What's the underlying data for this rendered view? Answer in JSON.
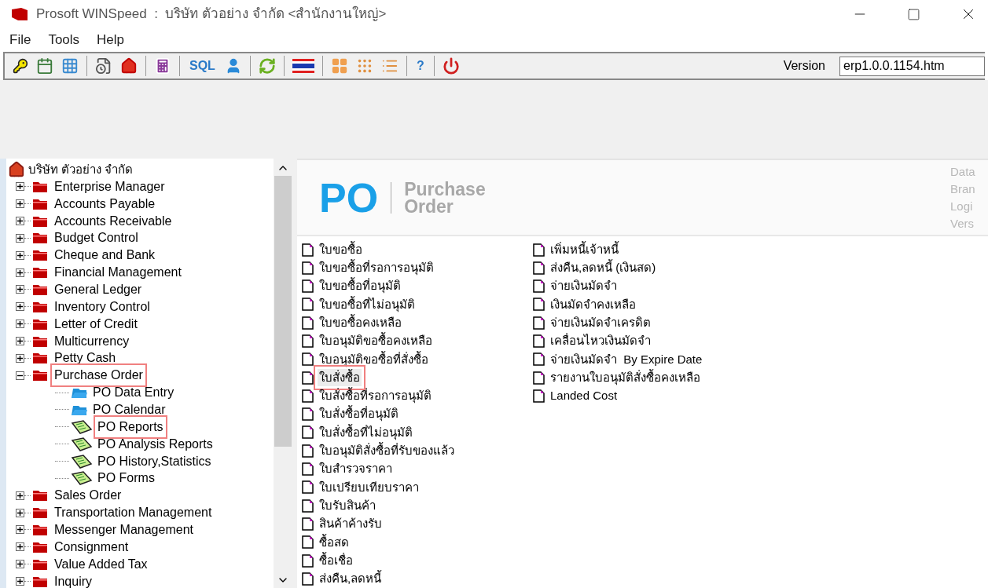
{
  "window": {
    "title": "Prosoft WINSpeed  :  บริษัท ตัวอย่าง จำกัด <สำนักงานใหญ่>"
  },
  "menu": [
    "File",
    "Tools",
    "Help"
  ],
  "toolbar": [
    {
      "kind": "key"
    },
    {
      "kind": "calendar"
    },
    {
      "kind": "grid"
    },
    {
      "kind": "separator"
    },
    {
      "kind": "history"
    },
    {
      "kind": "home"
    },
    {
      "kind": "separator"
    },
    {
      "kind": "calculator"
    },
    {
      "kind": "separator"
    },
    {
      "kind": "text",
      "label": "SQL"
    },
    {
      "kind": "user"
    },
    {
      "kind": "separator"
    },
    {
      "kind": "refresh"
    },
    {
      "kind": "separator"
    },
    {
      "kind": "flag"
    },
    {
      "kind": "separator"
    },
    {
      "kind": "tiles"
    },
    {
      "kind": "tiles-small"
    },
    {
      "kind": "list"
    },
    {
      "kind": "separator"
    },
    {
      "kind": "text",
      "label": "?"
    },
    {
      "kind": "separator"
    },
    {
      "kind": "power"
    }
  ],
  "version": {
    "label": "Version",
    "value": "erp1.0.0.1154.htm"
  },
  "tree": {
    "root": "บริษัท ตัวอย่าง จำกัด",
    "items": [
      {
        "label": "Enterprise Manager",
        "expanded": false,
        "highlighted": false
      },
      {
        "label": "Accounts Payable",
        "expanded": false,
        "highlighted": false
      },
      {
        "label": "Accounts Receivable",
        "expanded": false,
        "highlighted": false
      },
      {
        "label": "Budget Control",
        "expanded": false,
        "highlighted": false
      },
      {
        "label": "Cheque and Bank",
        "expanded": false,
        "highlighted": false
      },
      {
        "label": "Financial Management",
        "expanded": false,
        "highlighted": false
      },
      {
        "label": "General Ledger",
        "expanded": false,
        "highlighted": false
      },
      {
        "label": "Inventory Control",
        "expanded": false,
        "highlighted": false
      },
      {
        "label": "Letter of Credit",
        "expanded": false,
        "highlighted": false
      },
      {
        "label": "Multicurrency",
        "expanded": false,
        "highlighted": false
      },
      {
        "label": "Petty Cash",
        "expanded": false,
        "highlighted": false
      },
      {
        "label": "Purchase Order",
        "expanded": true,
        "highlighted": true,
        "children": [
          {
            "label": "PO Data Entry",
            "kind": "folder",
            "highlighted": false
          },
          {
            "label": "PO Calendar",
            "kind": "folder",
            "highlighted": false
          },
          {
            "label": "PO Reports",
            "kind": "report",
            "highlighted": true
          },
          {
            "label": "PO Analysis Reports",
            "kind": "report",
            "highlighted": false
          },
          {
            "label": "PO History,Statistics",
            "kind": "report",
            "highlighted": false
          },
          {
            "label": "PO Forms",
            "kind": "report",
            "highlighted": false
          }
        ]
      },
      {
        "label": "Sales Order",
        "expanded": false,
        "highlighted": false
      },
      {
        "label": "Transportation Management",
        "expanded": false,
        "highlighted": false
      },
      {
        "label": "Messenger Management",
        "expanded": false,
        "highlighted": false
      },
      {
        "label": "Consignment",
        "expanded": false,
        "highlighted": false
      },
      {
        "label": "Value Added Tax",
        "expanded": false,
        "highlighted": false
      },
      {
        "label": "Inquiry",
        "expanded": false,
        "highlighted": false
      }
    ]
  },
  "header": {
    "logo": "PO",
    "title_lines": [
      "Purchase",
      "Order"
    ],
    "info": [
      "Data",
      "Bran",
      "Logi",
      "Vers"
    ]
  },
  "reports": [
    [
      {
        "label": "ใบขอซื้อ",
        "selected": false,
        "highlighted": false
      },
      {
        "label": "ใบขอซื้อที่รอการอนุมัติ",
        "selected": false,
        "highlighted": false
      },
      {
        "label": "ใบขอซื้อที่อนุมัติ",
        "selected": false,
        "highlighted": false
      },
      {
        "label": "ใบขอซื้อที่ไม่อนุมัติ",
        "selected": false,
        "highlighted": false
      },
      {
        "label": "ใบขอซื้อคงเหลือ",
        "selected": false,
        "highlighted": false
      },
      {
        "label": "ใบอนุมัติขอซื้อคงเหลือ",
        "selected": false,
        "highlighted": false
      },
      {
        "label": "ใบอนุมัติขอซื้อที่สั่งซื้อ",
        "selected": false,
        "highlighted": false
      },
      {
        "label": "ใบสั่งซื้อ",
        "selected": true,
        "highlighted": true
      },
      {
        "label": "ใบสั่งซื้อที่รอการอนุมัติ",
        "selected": false,
        "highlighted": false
      },
      {
        "label": "ใบสั่งซื้อที่อนุมัติ",
        "selected": false,
        "highlighted": false
      },
      {
        "label": "ใบสั่งซื้อที่ไม่อนุมัติ",
        "selected": false,
        "highlighted": false
      },
      {
        "label": "ใบอนุมัติสั่งซื้อที่รับของแล้ว",
        "selected": false,
        "highlighted": false
      },
      {
        "label": "ใบสำรวจราคา",
        "selected": false,
        "highlighted": false
      },
      {
        "label": "ใบเปรียบเทียบราคา",
        "selected": false,
        "highlighted": false
      },
      {
        "label": "ใบรับสินค้า",
        "selected": false,
        "highlighted": false
      },
      {
        "label": "สินค้าค้างรับ",
        "selected": false,
        "highlighted": false
      },
      {
        "label": "ซื้อสด",
        "selected": false,
        "highlighted": false
      },
      {
        "label": "ซื้อเชื่อ",
        "selected": false,
        "highlighted": false
      },
      {
        "label": "ส่งคืน,ลดหนี้",
        "selected": false,
        "highlighted": false
      }
    ],
    [
      {
        "label": "เพิ่มหนี้เจ้าหนี้",
        "selected": false,
        "highlighted": false
      },
      {
        "label": "ส่งคืน,ลดหนี้ (เงินสด)",
        "selected": false,
        "highlighted": false
      },
      {
        "label": "จ่ายเงินมัดจำ",
        "selected": false,
        "highlighted": false
      },
      {
        "label": "เงินมัดจำคงเหลือ",
        "selected": false,
        "highlighted": false
      },
      {
        "label": "จ่ายเงินมัดจำเครดิต",
        "selected": false,
        "highlighted": false
      },
      {
        "label": "เคลื่อนไหวเงินมัดจำ",
        "selected": false,
        "highlighted": false
      },
      {
        "label": "จ่ายเงินมัดจำ  By Expire Date",
        "selected": false,
        "highlighted": false
      },
      {
        "label": "รายงานใบอนุมัติสั่งซื้อคงเหลือ",
        "selected": false,
        "highlighted": false
      },
      {
        "label": "Landed Cost",
        "selected": false,
        "highlighted": false
      }
    ]
  ]
}
